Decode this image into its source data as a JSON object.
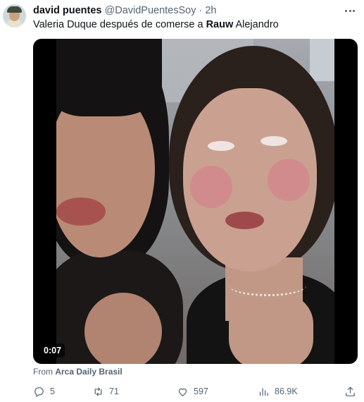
{
  "author": {
    "name": "david puentes",
    "handle": "@DavidPuentesSoy",
    "separator": "·",
    "time": "2h"
  },
  "tweet": {
    "text_before": "Valeria Duque después de comerse a ",
    "text_bold": "Rauw",
    "text_after": " Alejandro"
  },
  "media": {
    "duration": "0:07"
  },
  "source": {
    "prefix": "From",
    "name": "Arca Daily Brasil"
  },
  "actions": {
    "replies": "5",
    "retweets": "71",
    "likes": "597",
    "views": "86.9K"
  },
  "icons": [
    "more-icon",
    "reply-icon",
    "retweet-icon",
    "like-icon",
    "views-icon",
    "share-icon"
  ]
}
